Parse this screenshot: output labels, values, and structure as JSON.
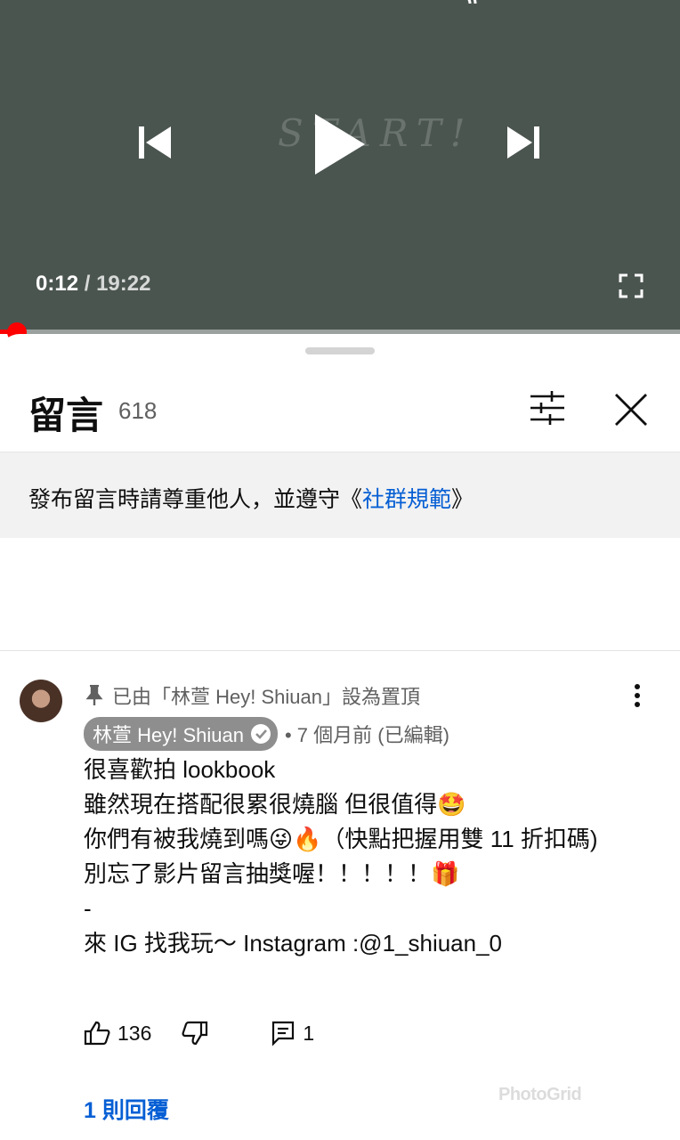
{
  "player": {
    "current_time": "0:12",
    "separator": " / ",
    "duration": "19:22",
    "overlay_text": "START!",
    "progress_fraction": 0.01,
    "accent_color": "#ff0000"
  },
  "comments_panel": {
    "title": "留言",
    "count": "618",
    "guideline_prefix": "發布留言時請尊重他人，並遵守《",
    "guideline_link": "社群規範",
    "guideline_suffix": "》",
    "link_color": "#065fd4"
  },
  "pinned_comment": {
    "pinned_label": "已由「林萱 Hey! Shiuan」設為置頂",
    "author": "林萱 Hey! Shiuan",
    "meta": "• 7 個月前 (已編輯)",
    "body_lines": [
      "很喜歡拍 lookbook",
      "雖然現在搭配很累很燒腦 但很值得🤩",
      "你們有被我燒到嗎😜🔥（快點把握用雙 11 折扣碼)",
      "別忘了影片留言抽獎喔！！！！！🎁",
      "-",
      "來 IG 找我玩～ Instagram :@1_shiuan_0"
    ],
    "likes": "136",
    "reply_count": "1",
    "replies_link": "1 則回覆"
  },
  "watermark": "PhotoGrid",
  "icons": [
    "previous-icon",
    "play-icon",
    "next-icon",
    "fullscreen-icon",
    "cast-icon",
    "filter-icon",
    "close-icon",
    "pin-icon",
    "more-icon",
    "verified-icon",
    "like-icon",
    "dislike-icon",
    "reply-icon"
  ]
}
